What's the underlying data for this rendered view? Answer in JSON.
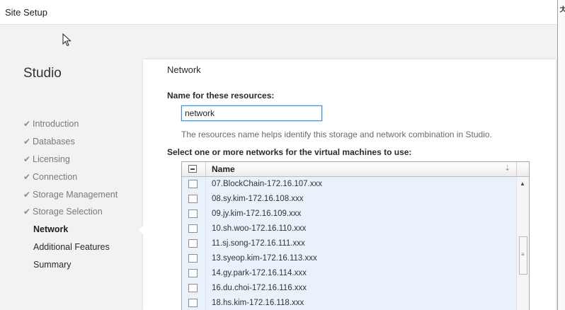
{
  "window": {
    "title": "Site Setup"
  },
  "background": {
    "side_char": "ㅊ"
  },
  "nav": {
    "title": "Studio",
    "items": [
      {
        "label": "Introduction",
        "state": "done"
      },
      {
        "label": "Databases",
        "state": "done"
      },
      {
        "label": "Licensing",
        "state": "done"
      },
      {
        "label": "Connection",
        "state": "done"
      },
      {
        "label": "Storage Management",
        "state": "done"
      },
      {
        "label": "Storage Selection",
        "state": "done"
      },
      {
        "label": "Network",
        "state": "active"
      },
      {
        "label": "Additional Features",
        "state": "pending"
      },
      {
        "label": "Summary",
        "state": "pending"
      }
    ],
    "check_glyph": "✔"
  },
  "content": {
    "section_title": "Network",
    "name_label": "Name for these resources:",
    "name_value": "network",
    "help_text": "The resources name helps identify this storage and network combination in Studio.",
    "networks_label": "Select one or more networks for the virtual machines to use:",
    "grid": {
      "column_name": "Name",
      "rows": [
        {
          "name": "07.BlockChain-172.16.107.xxx",
          "checked": false
        },
        {
          "name": "08.sy.kim-172.16.108.xxx",
          "checked": false
        },
        {
          "name": "09.jy.kim-172.16.109.xxx",
          "checked": false
        },
        {
          "name": "10.sh.woo-172.16.110.xxx",
          "checked": false
        },
        {
          "name": "11.sj.song-172.16.111.xxx",
          "checked": false
        },
        {
          "name": "13.syeop.kim-172.16.113.xxx",
          "checked": false
        },
        {
          "name": "14.gy.park-172.16.114.xxx",
          "checked": false
        },
        {
          "name": "16.du.choi-172.16.116.xxx",
          "checked": false
        },
        {
          "name": "18.hs.kim-172.16.118.xxx",
          "checked": false
        }
      ]
    }
  },
  "colors": {
    "row_background": "#e9f2fb",
    "input_focus_border": "#3d8ee6",
    "window_background": "#f2f2f2"
  }
}
